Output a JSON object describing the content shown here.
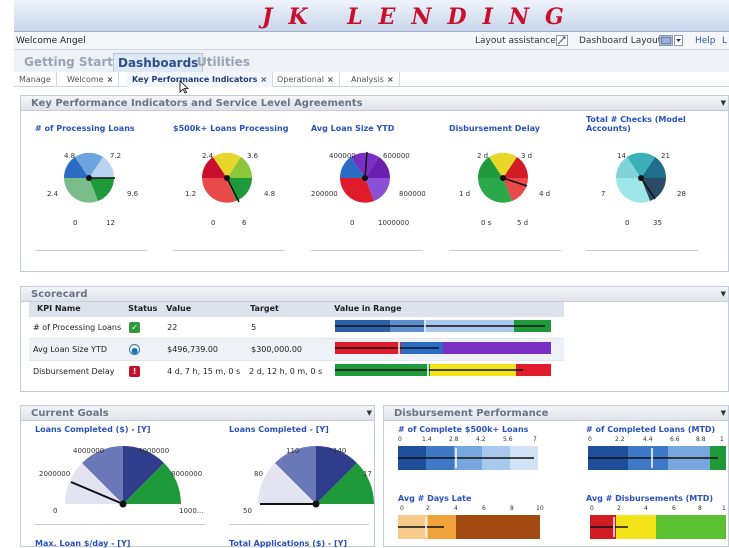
{
  "app": {
    "title": "JK LENDING"
  },
  "topbar": {
    "welcome": "Welcome Angel",
    "layout_assistance": "Layout assistance",
    "dashboard_layout": "Dashboard Layout",
    "help": "Help",
    "trailing": "L"
  },
  "nav": {
    "items": [
      "Getting Started",
      "Dashboards",
      "Utilities"
    ],
    "active": "Dashboards"
  },
  "tabs": [
    {
      "label": "Manage",
      "closable": false
    },
    {
      "label": "Welcome",
      "closable": true
    },
    {
      "label": "Key Performance Indicators",
      "closable": true,
      "active": true
    },
    {
      "label": "Operational",
      "closable": true
    },
    {
      "label": "Analysis",
      "closable": true
    }
  ],
  "kpi_panel": {
    "title": "Key Performance Indicators and Service Level Agreements",
    "gauges": [
      {
        "title": "# of Processing Loans",
        "labels": [
          "4.8",
          "7.2",
          "2.4",
          "9.6",
          "0",
          "12"
        ]
      },
      {
        "title": "$500k+ Loans Processing",
        "labels": [
          "2.4",
          "3.6",
          "1.2",
          "4.8",
          "0",
          "6"
        ]
      },
      {
        "title": "Avg Loan Size YTD",
        "labels": [
          "400000",
          "600000",
          "200000",
          "800000",
          "0",
          "1000000"
        ]
      },
      {
        "title": "Disbursement Delay",
        "labels": [
          "2 d",
          "3 d",
          "1 d",
          "4 d",
          "0 s",
          "5 d"
        ]
      },
      {
        "title": "Total # Checks (Model Accounts)",
        "labels": [
          "14",
          "21",
          "7",
          "28",
          "0",
          "35"
        ]
      }
    ]
  },
  "scorecard": {
    "title": "Scorecard",
    "columns": [
      "KPI Name",
      "Status",
      "Value",
      "Target",
      "Value in Range"
    ],
    "rows": [
      {
        "name": "# of Processing Loans",
        "status": "check",
        "value": "22",
        "target": "5"
      },
      {
        "name": "Avg Loan Size YTD",
        "status": "circle",
        "value": "$496,739.00",
        "target": "$300,000.00"
      },
      {
        "name": "Disbursement Delay",
        "status": "alert",
        "value": "4 d, 7 h, 15 m, 0 s",
        "target": "2 d, 12 h, 0 m, 0 s"
      }
    ]
  },
  "goals_panel": {
    "title": "Current Goals",
    "gauges": [
      {
        "title": "Loans Completed ($) - [Y]",
        "labels": [
          "4000000",
          "6000000",
          "2000000",
          "8000000",
          "0",
          "1000..."
        ]
      },
      {
        "title": "Loans Completed - [Y]",
        "labels": [
          "110",
          "140",
          "80",
          "17",
          "50"
        ]
      }
    ],
    "more": [
      "Max. Loan $/day - [Y]",
      "Total Applications ($) - [Y]"
    ]
  },
  "disb_panel": {
    "title": "Disbursement Performance",
    "charts": [
      {
        "title": "# of Complete $500k+ Loans",
        "ticks": [
          "0",
          "1.4",
          "2.8",
          "4.2",
          "5.6",
          "7"
        ]
      },
      {
        "title": "# of Completed Loans (MTD)",
        "ticks": [
          "0",
          "2.2",
          "4.4",
          "6.6",
          "8.8",
          "1"
        ]
      },
      {
        "title": "Avg # Days Late",
        "ticks": [
          "0",
          "2",
          "4",
          "6",
          "8",
          "10"
        ]
      },
      {
        "title": "Avg # Disbursements (MTD)",
        "ticks": [
          "0",
          "2",
          "4",
          "6",
          "8",
          "1"
        ]
      }
    ]
  },
  "colors": {
    "brand": "#c8102e",
    "link": "#2a52be"
  }
}
